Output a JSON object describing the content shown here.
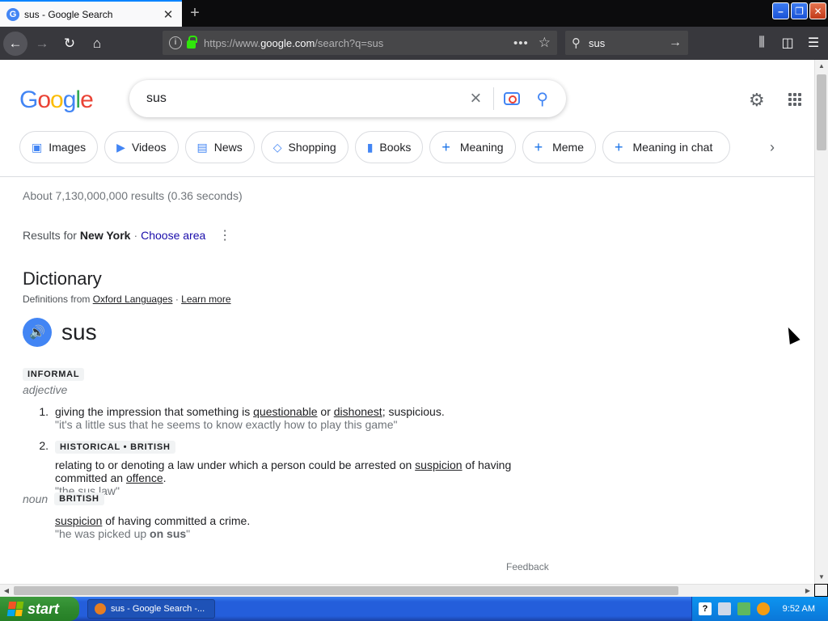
{
  "browser": {
    "tab_title": "sus - Google Search",
    "tab_favicon": "G",
    "url_prefix": "https://www.",
    "url_domain": "google.com",
    "url_path": "/search?q=sus",
    "search_box_value": "sus",
    "accent": "#0a84ff"
  },
  "google": {
    "logo": [
      "G",
      "o",
      "o",
      "g",
      "l",
      "e"
    ],
    "query": "sus",
    "chips": [
      {
        "label": "Images",
        "icon": "image-icon"
      },
      {
        "label": "Videos",
        "icon": "video-icon"
      },
      {
        "label": "News",
        "icon": "news-icon"
      },
      {
        "label": "Shopping",
        "icon": "tag-icon"
      },
      {
        "label": "Books",
        "icon": "book-icon"
      },
      {
        "label": "Meaning",
        "icon": "plus-icon"
      },
      {
        "label": "Meme",
        "icon": "plus-icon"
      },
      {
        "label": "Meaning in chat",
        "icon": "plus-icon"
      }
    ],
    "result_stats": "About 7,130,000,000 results (0.36 seconds)",
    "results_for_label": "Results for",
    "location": "New York",
    "choose_area": "Choose area"
  },
  "dictionary": {
    "heading": "Dictionary",
    "source_prefix": "Definitions from",
    "source_name": "Oxford Languages",
    "learn_more": "Learn more",
    "word": "sus",
    "register_badge": "INFORMAL",
    "pos_adjective": "adjective",
    "def1": {
      "num": "1.",
      "before": "giving the impression that something is ",
      "link1": "questionable",
      "mid": " or ",
      "link2": "dishonest",
      "after": "; suspicious.",
      "example": "\"it's a little sus that he seems to know exactly how to play this game\""
    },
    "def2": {
      "num": "2.",
      "badge": "HISTORICAL • BRITISH",
      "before": "relating to or denoting a law under which a person could be arrested on ",
      "link1": "suspicion",
      "mid": " of having committed an ",
      "link2": "offence",
      "after": ".",
      "example": "\"the sus law\""
    },
    "pos_noun": "noun",
    "noun_badge": "BRITISH",
    "noun_def": {
      "link": "suspicion",
      "after": " of having committed a crime.",
      "example_before": "\"he was picked up ",
      "example_bold": "on sus",
      "example_after": "\""
    },
    "feedback": "Feedback"
  },
  "taskbar": {
    "start_label": "start",
    "task_item": "sus - Google Search -...",
    "time": "9:52 AM",
    "help_glyph": "?"
  }
}
